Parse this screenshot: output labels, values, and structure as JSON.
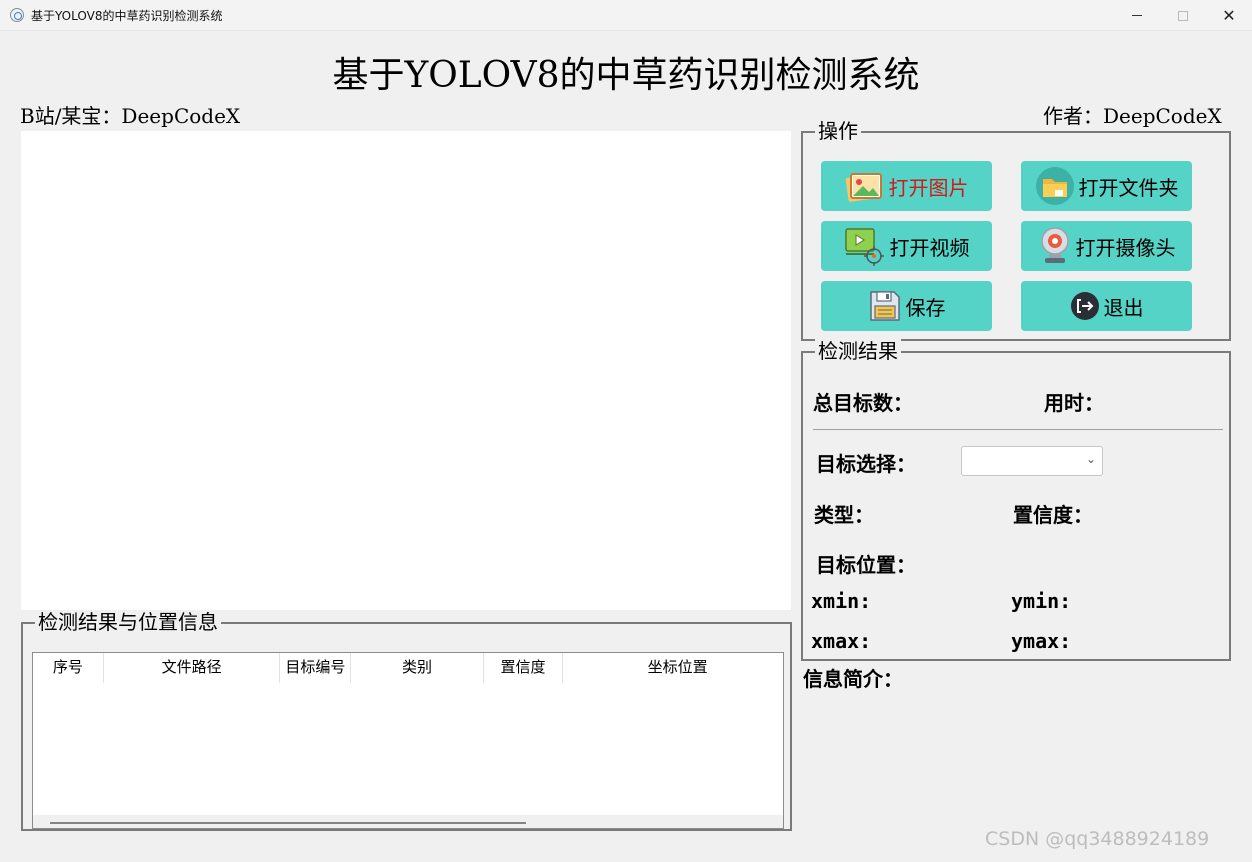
{
  "window": {
    "title": "基于YOLOV8的中草药识别检测系统",
    "close_glyph": "✕"
  },
  "header": {
    "main_title": "基于YOLOV8的中草药识别检测系统",
    "left_text": "B站/某宝：DeepCodeX",
    "right_text": "作者：DeepCodeX"
  },
  "results_panel": {
    "title": "检测结果与位置信息",
    "columns": [
      "序号",
      "文件路径",
      "目标编号",
      "类别",
      "置信度",
      "坐标位置"
    ],
    "rows": []
  },
  "operations": {
    "title": "操作",
    "open_image": "打开图片",
    "open_folder": "打开文件夹",
    "open_video": "打开视频",
    "open_camera": "打开摄像头",
    "save": "保存",
    "exit": "退出"
  },
  "detection": {
    "title": "检测结果",
    "total_targets_label": "总目标数：",
    "time_label": "用时：",
    "target_select_label": "目标选择：",
    "target_select_value": "",
    "type_label": "类型：",
    "confidence_label": "置信度：",
    "position_label": "目标位置：",
    "xmin_label": "xmin:",
    "ymin_label": "ymin:",
    "xmax_label": "xmax:",
    "ymax_label": "ymax:"
  },
  "info": {
    "label": "信息简介："
  },
  "watermark": "CSDN @qq3488924189",
  "colors": {
    "button_bg": "#55d3c7",
    "open_image_text": "#d11a1a"
  }
}
